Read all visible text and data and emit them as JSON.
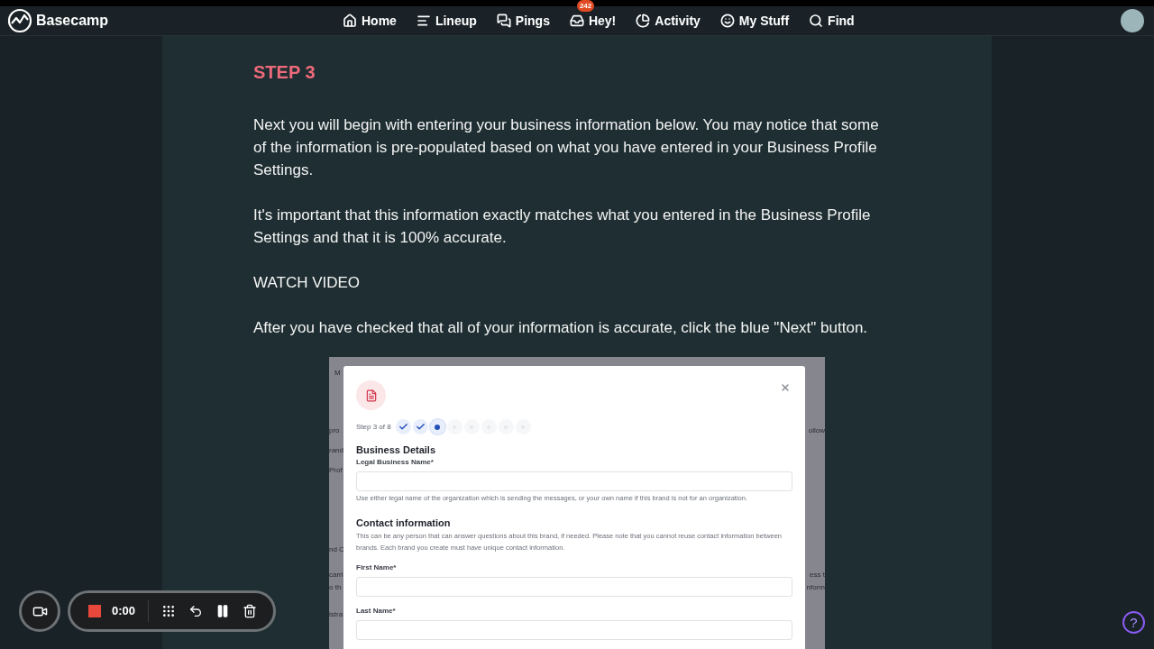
{
  "app": {
    "name": "Basecamp"
  },
  "nav": [
    {
      "kind": "home",
      "label": "Home"
    },
    {
      "kind": "lineup",
      "label": "Lineup"
    },
    {
      "kind": "pings",
      "label": "Pings"
    },
    {
      "kind": "hey",
      "label": "Hey!",
      "badge": "242"
    },
    {
      "kind": "activity",
      "label": "Activity"
    },
    {
      "kind": "mystuff",
      "label": "My Stuff"
    },
    {
      "kind": "find",
      "label": "Find"
    }
  ],
  "article": {
    "heading": "STEP 3",
    "paragraphs": [
      "Next you will begin with entering your business information below. You may notice that some of the information is pre-populated based on what you have entered in your Business Profile Settings.",
      "It's important that this information exactly matches what you entered in the Business Profile Settings and that it is 100% accurate.",
      "WATCH VIDEO",
      "After you have checked that all of your information is accurate, click the blue \"Next\" button."
    ]
  },
  "screenshot": {
    "background_fragments": [
      "M",
      "pro",
      "ollow",
      "rand",
      "Prof",
      "nd C",
      "carri",
      "ess t",
      "o th",
      "nform",
      "istra"
    ],
    "modal": {
      "step_label": "Step 3 of 8",
      "steps": [
        {
          "completed": true,
          "selected": false
        },
        {
          "completed": true,
          "selected": false
        },
        {
          "completed": false,
          "selected": true
        },
        {
          "completed": false,
          "selected": false
        },
        {
          "completed": false,
          "selected": false
        },
        {
          "completed": false,
          "selected": false
        },
        {
          "completed": false,
          "selected": false
        },
        {
          "completed": false,
          "selected": false
        }
      ],
      "sections": [
        {
          "title": "Business Details",
          "fields": [
            {
              "label": "Legal Business Name*",
              "help": "Use either legal name of the organization which is sending the messages, or your own name if this brand is not for an organization."
            }
          ]
        },
        {
          "title": "Contact information",
          "description": "This can be any person that can answer questions about this brand, if needed. Please note that you cannot reuse contact information between brands. Each brand you create must have unique contact information.",
          "fields": [
            {
              "label": "First Name*"
            },
            {
              "label": "Last Name*"
            }
          ]
        }
      ]
    }
  },
  "recorder": {
    "time": "0:00"
  },
  "help": {
    "label": "?"
  }
}
